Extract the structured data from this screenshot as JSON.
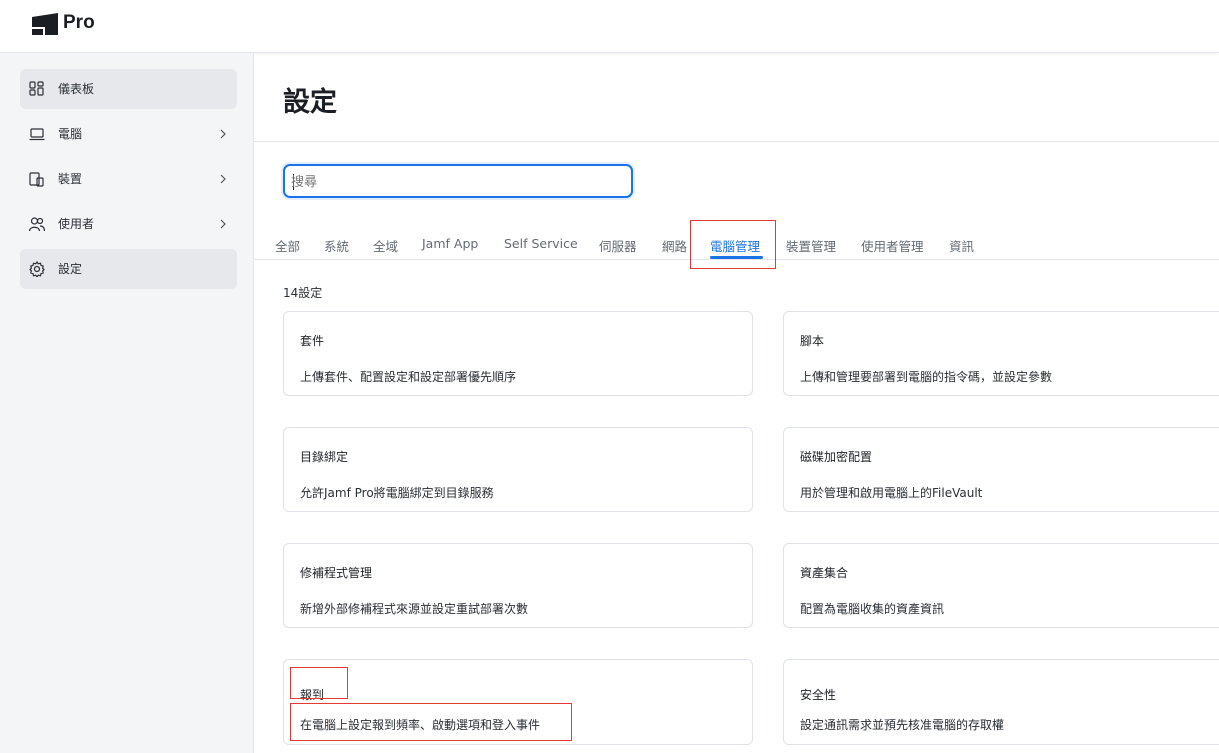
{
  "app": {
    "name": "Pro"
  },
  "sidebar": {
    "items": [
      {
        "label": "儀表板",
        "icon": "dashboard-icon",
        "has_chevron": false,
        "active": true
      },
      {
        "label": "電腦",
        "icon": "laptop-icon",
        "has_chevron": true,
        "active": false
      },
      {
        "label": "裝置",
        "icon": "devices-icon",
        "has_chevron": true,
        "active": false
      },
      {
        "label": "使用者",
        "icon": "users-icon",
        "has_chevron": true,
        "active": false
      },
      {
        "label": "設定",
        "icon": "gear-icon",
        "has_chevron": false,
        "active": true
      }
    ]
  },
  "main": {
    "title": "設定",
    "search": {
      "value": "",
      "placeholder": "搜尋"
    },
    "tabs": [
      {
        "label": "全部"
      },
      {
        "label": "系統"
      },
      {
        "label": "全域"
      },
      {
        "label": "Jamf App"
      },
      {
        "label": "Self Service"
      },
      {
        "label": "伺服器"
      },
      {
        "label": "網路"
      },
      {
        "label": "電腦管理",
        "active": true
      },
      {
        "label": "裝置管理"
      },
      {
        "label": "使用者管理"
      },
      {
        "label": "資訊"
      }
    ],
    "count_label": "14設定",
    "cards": [
      {
        "title": "套件",
        "desc": "上傳套件、配置設定和設定部署優先順序"
      },
      {
        "title": "腳本",
        "desc": "上傳和管理要部署到電腦的指令碼，並設定參數"
      },
      {
        "title": "目錄綁定",
        "desc": "允許Jamf Pro將電腦綁定到目錄服務"
      },
      {
        "title": "磁碟加密配置",
        "desc": "用於管理和啟用電腦上的FileVault"
      },
      {
        "title": "修補程式管理",
        "desc": "新增外部修補程式來源並設定重試部署次數"
      },
      {
        "title": "資產集合",
        "desc": "配置為電腦收集的資產資訊"
      },
      {
        "title": "報到",
        "desc": "在電腦上設定報到頻率、啟動選項和登入事件"
      },
      {
        "title": "安全性",
        "desc": "設定通訊需求並預先核准電腦的存取權"
      }
    ]
  },
  "colors": {
    "accent": "#1a73e8",
    "highlight": "#e53935"
  }
}
